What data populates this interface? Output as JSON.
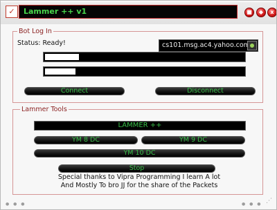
{
  "window": {
    "title": "Lammer ++ v1"
  },
  "title_controls": {
    "minimize": "■",
    "restore": "◆",
    "close": "x"
  },
  "bot_login": {
    "legend": "Bot Log In",
    "status": "Status: Ready!",
    "server": "cs101.msg.ac4.yahoo.com",
    "username_value": "",
    "password_value": "",
    "connect_label": "Connect",
    "disconnect_label": "Disconnect"
  },
  "tools": {
    "legend": "Lammer Tools",
    "banner": "LAMMER ++",
    "ym8_label": "YM 8 DC",
    "ym9_label": "YM 9 DC",
    "ym10_label": "YM 10 DC",
    "stop_label": "Stop",
    "thanks_line1": "Special thanks to Vipra Programming I learn A lot",
    "thanks_line2": "And Mostly To bro JJ for the share of the Packets"
  },
  "colors": {
    "accent_green": "#38bd48",
    "border_red": "#c22a2a"
  }
}
